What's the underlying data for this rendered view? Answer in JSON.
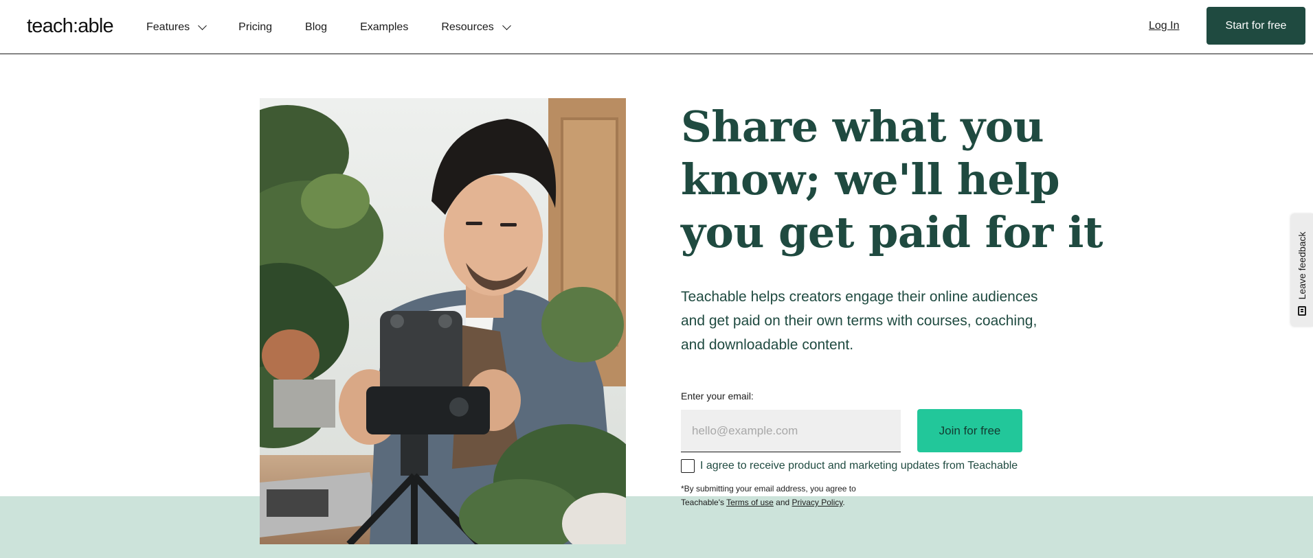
{
  "header": {
    "logo": "teach:able",
    "nav": [
      {
        "label": "Features",
        "has_dropdown": true
      },
      {
        "label": "Pricing",
        "has_dropdown": false
      },
      {
        "label": "Blog",
        "has_dropdown": false
      },
      {
        "label": "Examples",
        "has_dropdown": false
      },
      {
        "label": "Resources",
        "has_dropdown": true
      }
    ],
    "login_label": "Log In",
    "cta_label": "Start for free"
  },
  "hero": {
    "headline_lines": [
      "Share what you",
      "know; we'll help",
      "you get paid for it"
    ],
    "subcopy": "Teachable helps creators engage their online audiences and get paid on their own terms with courses, coaching, and downloadable content.",
    "email_label": "Enter your email:",
    "email_placeholder": "hello@example.com",
    "email_value": "",
    "join_label": "Join for free",
    "consent_checked": false,
    "consent_text": "I agree to receive product and marketing updates from Teachable",
    "legal_prefix": "*By submitting your email address, you agree to Teachable's",
    "terms_label": "Terms of use",
    "legal_and": "and",
    "privacy_label": "Privacy Policy",
    "legal_suffix": "."
  },
  "feedback": {
    "label": "Leave feedback"
  },
  "colors": {
    "brand_dark": "#1f4a40",
    "accent_green": "#22c79a",
    "band_mint": "#cce3da"
  },
  "icons": [
    "chevron-down-icon",
    "feedback-icon"
  ]
}
